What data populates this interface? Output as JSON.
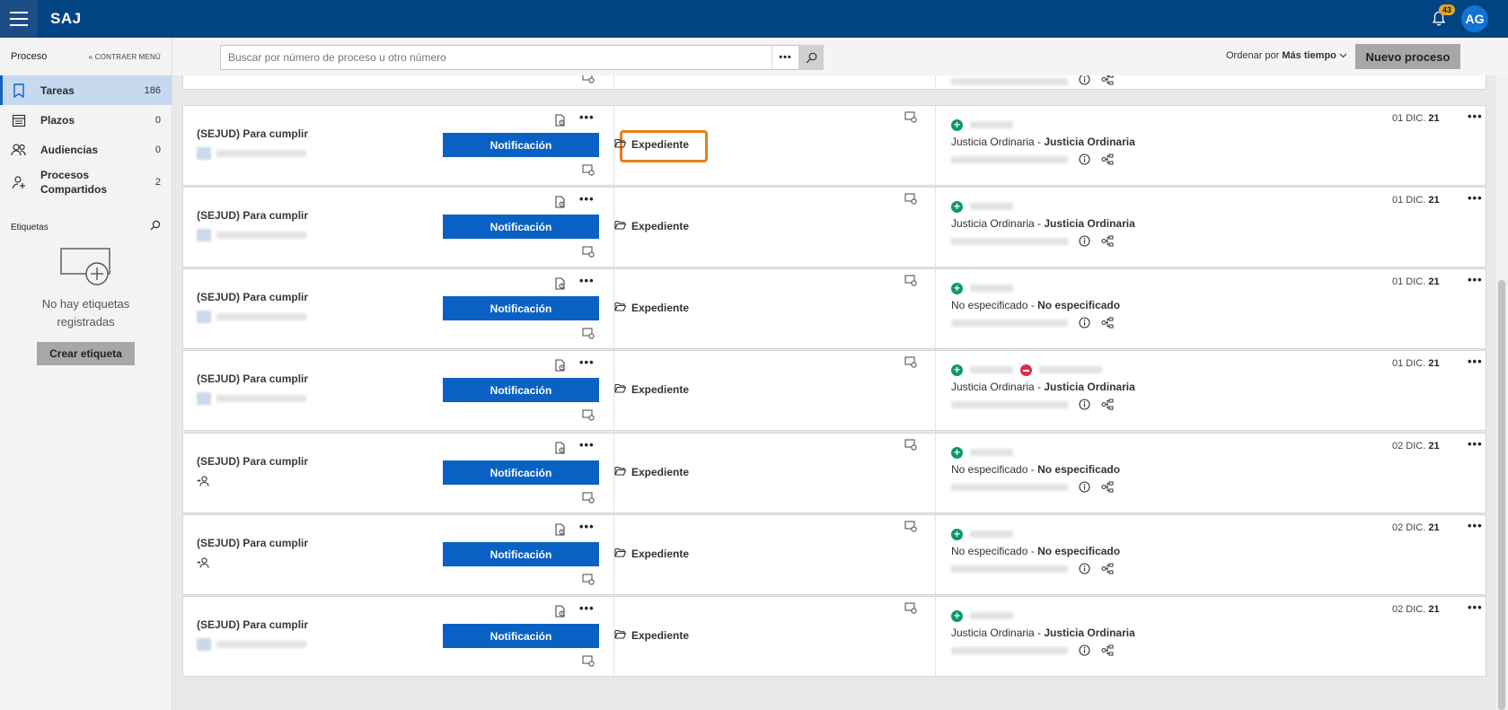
{
  "app": {
    "brand": "SAJ",
    "notifications_count": "43",
    "user_initials": "AG"
  },
  "sidebar": {
    "title": "Proceso",
    "collapse_label": "CONTRAER MENÚ",
    "items": [
      {
        "label": "Tareas",
        "count": "186",
        "icon": "bookmark-icon"
      },
      {
        "label": "Plazos",
        "count": "0",
        "icon": "calendar-icon"
      },
      {
        "label": "Audiencias",
        "count": "0",
        "icon": "people-icon"
      },
      {
        "label": "Procesos Compartidos",
        "count": "2",
        "icon": "shared-user-icon"
      }
    ],
    "tags_label": "Etiquetas",
    "no_tags_text": "No hay etiquetas registradas",
    "create_tag_label": "Crear etiqueta"
  },
  "toolbar": {
    "search_placeholder": "Buscar por número de proceso u otro número",
    "more_label": "•••",
    "sort_prefix": "Ordenar por",
    "sort_value": "Más tiempo",
    "new_process_label": "Nuevo proceso"
  },
  "cards": [
    {
      "title": "(SEJUD) Para cumplir",
      "action": "Notificación",
      "expediente": "Expediente",
      "jurisdiction": "Justicia Ordinaria",
      "jurisdiction_bold": "Justicia Ordinaria",
      "date_prefix": "01 DIC.",
      "date_year": "21",
      "highlight": true,
      "user_icon": false,
      "minus": false
    },
    {
      "title": "(SEJUD) Para cumplir",
      "action": "Notificación",
      "expediente": "Expediente",
      "jurisdiction": "Justicia Ordinaria",
      "jurisdiction_bold": "Justicia Ordinaria",
      "date_prefix": "01 DIC.",
      "date_year": "21",
      "highlight": false,
      "user_icon": false,
      "minus": false
    },
    {
      "title": "(SEJUD) Para cumplir",
      "action": "Notificación",
      "expediente": "Expediente",
      "jurisdiction": "No especificado",
      "jurisdiction_bold": "No especificado",
      "date_prefix": "01 DIC.",
      "date_year": "21",
      "highlight": false,
      "user_icon": false,
      "minus": false
    },
    {
      "title": "(SEJUD) Para cumplir",
      "action": "Notificación",
      "expediente": "Expediente",
      "jurisdiction": "Justicia Ordinaria",
      "jurisdiction_bold": "Justicia Ordinaria",
      "date_prefix": "01 DIC.",
      "date_year": "21",
      "highlight": false,
      "user_icon": false,
      "minus": true
    },
    {
      "title": "(SEJUD) Para cumplir",
      "action": "Notificación",
      "expediente": "Expediente",
      "jurisdiction": "No especificado",
      "jurisdiction_bold": "No especificado",
      "date_prefix": "02 DIC.",
      "date_year": "21",
      "highlight": false,
      "user_icon": true,
      "minus": false
    },
    {
      "title": "(SEJUD) Para cumplir",
      "action": "Notificación",
      "expediente": "Expediente",
      "jurisdiction": "No especificado",
      "jurisdiction_bold": "No especificado",
      "date_prefix": "02 DIC.",
      "date_year": "21",
      "highlight": false,
      "user_icon": true,
      "minus": false
    },
    {
      "title": "(SEJUD) Para cumplir",
      "action": "Notificación",
      "expediente": "Expediente",
      "jurisdiction": "Justicia Ordinaria",
      "jurisdiction_bold": "Justicia Ordinaria",
      "date_prefix": "02 DIC.",
      "date_year": "21",
      "highlight": false,
      "user_icon": false,
      "minus": false
    }
  ],
  "colors": {
    "topbar": "#004483",
    "primary_button": "#0a61c4",
    "highlight_border": "#e97c1c",
    "badge": "#e5a722",
    "add_status": "#0c9a63",
    "remove_status": "#d6314b"
  }
}
